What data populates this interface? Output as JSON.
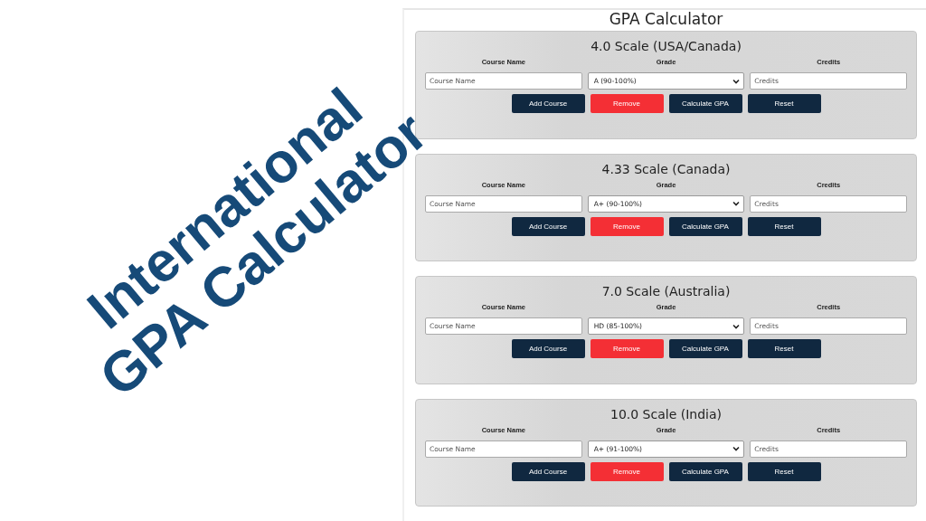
{
  "headline": {
    "lines": [
      "International",
      "GPA Calculator"
    ]
  },
  "page": {
    "title": "GPA Calculator",
    "scales": [
      {
        "title": "4.0 Scale (USA/Canada)",
        "columns": [
          "Course Name",
          "Grade",
          "Credits"
        ],
        "course_placeholder": "Course Name",
        "grade": "A (90-100%)",
        "credits_placeholder": "Credits",
        "buttons": [
          {
            "label": "Add Course",
            "kind": "primary"
          },
          {
            "label": "Remove",
            "kind": "danger"
          },
          {
            "label": "Calculate GPA",
            "kind": "primary"
          },
          {
            "label": "Reset",
            "kind": "primary"
          }
        ]
      },
      {
        "title": "4.33 Scale (Canada)",
        "columns": [
          "Course Name",
          "Grade",
          "Credits"
        ],
        "course_placeholder": "Course Name",
        "grade": "A+ (90-100%)",
        "credits_placeholder": "Credits",
        "buttons": [
          {
            "label": "Add Course",
            "kind": "primary"
          },
          {
            "label": "Remove",
            "kind": "danger"
          },
          {
            "label": "Calculate GPA",
            "kind": "primary"
          },
          {
            "label": "Reset",
            "kind": "primary"
          }
        ]
      },
      {
        "title": "7.0 Scale (Australia)",
        "columns": [
          "Course Name",
          "Grade",
          "Credits"
        ],
        "course_placeholder": "Course Name",
        "grade": "HD (85-100%)",
        "credits_placeholder": "Credits",
        "buttons": [
          {
            "label": "Add Course",
            "kind": "primary"
          },
          {
            "label": "Remove",
            "kind": "danger"
          },
          {
            "label": "Calculate GPA",
            "kind": "primary"
          },
          {
            "label": "Reset",
            "kind": "primary"
          }
        ]
      },
      {
        "title": "10.0 Scale (India)",
        "columns": [
          "Course Name",
          "Grade",
          "Credits"
        ],
        "course_placeholder": "Course Name",
        "grade": "A+ (91-100%)",
        "credits_placeholder": "Credits",
        "buttons": [
          {
            "label": "Add Course",
            "kind": "primary"
          },
          {
            "label": "Remove",
            "kind": "danger"
          },
          {
            "label": "Calculate GPA",
            "kind": "primary"
          },
          {
            "label": "Reset",
            "kind": "primary"
          }
        ]
      }
    ]
  }
}
